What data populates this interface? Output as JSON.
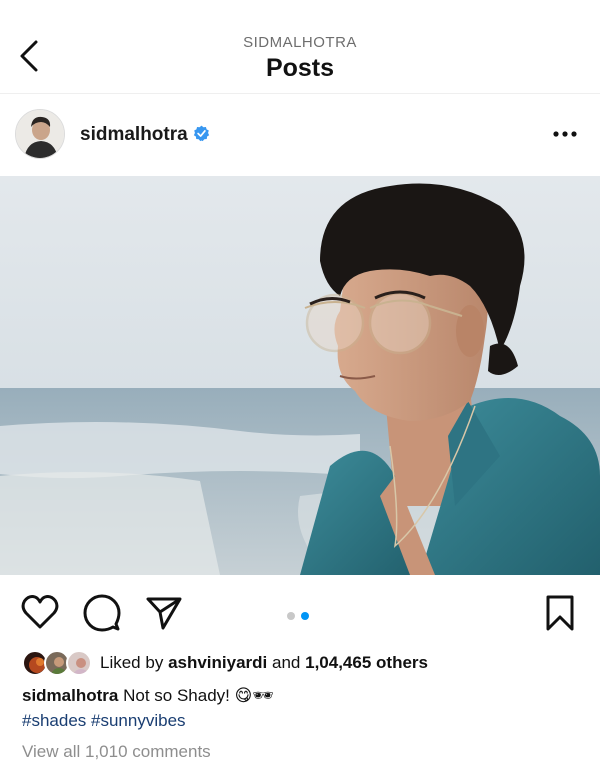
{
  "header": {
    "username": "SIDMALHOTRA",
    "title": "Posts",
    "back_icon": "chevron-left-icon"
  },
  "post": {
    "username": "sidmalhotra",
    "verified": true,
    "more_icon": "more-horizontal-icon",
    "carousel": {
      "total": 2,
      "current": 2
    },
    "actions": [
      "heart-icon",
      "comment-icon",
      "send-icon",
      "bookmark-icon"
    ],
    "likes": {
      "prefix": "Liked by",
      "user": "ashviniyardi",
      "connector": "and",
      "others": "1,04,465 others"
    },
    "caption": {
      "username": "sidmalhotra",
      "text": "Not so Shady! 😋🕶"
    },
    "hashtags": [
      "#shades",
      "#sunnyvibes"
    ],
    "view_comments": "View all 1,010 comments"
  },
  "colors": {
    "verified": "#3897f0",
    "hashtag": "#1a3e72",
    "carousel_active": "#0095f6",
    "carousel_inactive": "#c8c8c8",
    "muted": "#8e8e8e"
  }
}
